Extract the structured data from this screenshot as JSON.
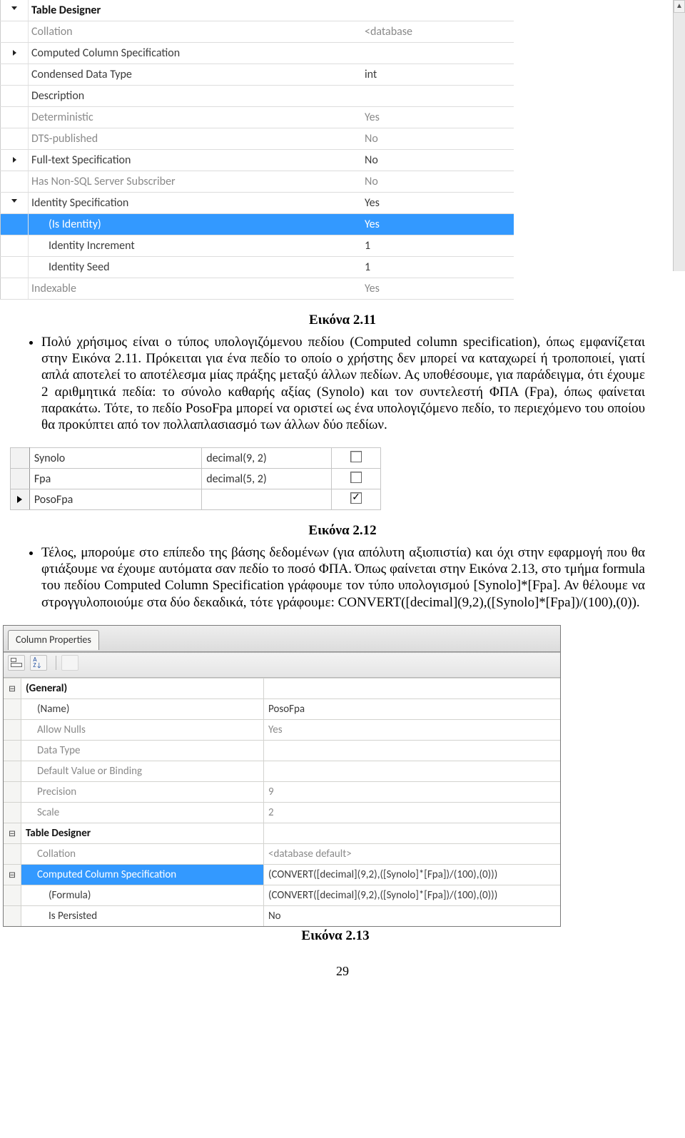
{
  "panel1": {
    "rows": [
      {
        "exp": "open",
        "label": "Table Designer",
        "value": "",
        "style": "header"
      },
      {
        "exp": "",
        "label": "Collation",
        "value": "<database",
        "style": "grey"
      },
      {
        "exp": "right",
        "label": "Computed Column Specification",
        "value": "",
        "style": ""
      },
      {
        "exp": "",
        "label": "Condensed Data Type",
        "value": "int",
        "style": ""
      },
      {
        "exp": "",
        "label": "Description",
        "value": "",
        "style": ""
      },
      {
        "exp": "",
        "label": "Deterministic",
        "value": "Yes",
        "style": "grey"
      },
      {
        "exp": "",
        "label": "DTS-published",
        "value": "No",
        "style": "grey"
      },
      {
        "exp": "right",
        "label": "Full-text Specification",
        "value": "No",
        "style": ""
      },
      {
        "exp": "",
        "label": "Has Non-SQL Server Subscriber",
        "value": "No",
        "style": "grey"
      },
      {
        "exp": "open",
        "label": "Identity Specification",
        "value": "Yes",
        "style": ""
      },
      {
        "exp": "",
        "label": "(Is Identity)",
        "value": "Yes",
        "style": "selected"
      },
      {
        "exp": "",
        "label": "Identity Increment",
        "value": "1",
        "style": "sub"
      },
      {
        "exp": "",
        "label": "Identity Seed",
        "value": "1",
        "style": "sub"
      },
      {
        "exp": "",
        "label": "Indexable",
        "value": "Yes",
        "style": "last"
      }
    ]
  },
  "cap1": "Εικόνα 2.11",
  "para1": "Πολύ χρήσιμος είναι ο τύπος υπολογιζόμενου πεδίου (Computed column specification), όπως εμφανίζεται στην Εικόνα 2.11. Πρόκειται για ένα πεδίο το οποίο ο χρήστης δεν μπορεί να καταχωρεί ή τροποποιεί, γιατί απλά αποτελεί το αποτέλεσμα μίας πράξης μεταξύ άλλων πεδίων. Ας υποθέσουμε, για παράδειγμα, ότι έχουμε 2 αριθμητικά πεδία: το σύνολο καθαρής αξίας (Synolo) και τον συντελεστή ΦΠΑ (Fpa), όπως φαίνεται παρακάτω. Τότε, το πεδίο PosoFpa μπορεί να οριστεί ως ένα υπολογιζόμενο πεδίο, το περιεχόμενο του οποίου θα προκύπτει από τον πολλαπλασιασμό των άλλων δύο πεδίων.",
  "grid": {
    "rows": [
      {
        "ptr": false,
        "name": "Synolo",
        "type": "decimal(9, 2)",
        "chk": false
      },
      {
        "ptr": false,
        "name": "Fpa",
        "type": "decimal(5, 2)",
        "chk": false
      },
      {
        "ptr": true,
        "name": "PosoFpa",
        "type": "",
        "chk": true
      }
    ]
  },
  "cap2": "Εικόνα 2.12",
  "para2": "Τέλος, μπορούμε στο επίπεδο της βάσης δεδομένων (για απόλυτη αξιοπιστία) και όχι στην εφαρμογή που θα φτιάξουμε να έχουμε αυτόματα σαν πεδίο το ποσό ΦΠΑ. Όπως φαίνεται στην Εικόνα 2.13, στο τμήμα formula του πεδίου Computed Column Specification γράφουμε τον τύπο υπολογισμού [Synolo]*[Fpa]. Αν θέλουμε να στρογγυλοποιούμε στα δύο δεκαδικά, τότε γράφουμε: CONVERT([decimal](9,2),([Synolo]*[Fpa])/(100),(0)).",
  "panel3": {
    "tab": "Column Properties",
    "rows": [
      {
        "exp": "⊟",
        "label": "(General)",
        "value": "",
        "style": "cat"
      },
      {
        "exp": "",
        "label": "(Name)",
        "value": "PosoFpa",
        "style": "sub"
      },
      {
        "exp": "",
        "label": "Allow Nulls",
        "value": "Yes",
        "style": "sub grey"
      },
      {
        "exp": "",
        "label": "Data Type",
        "value": "",
        "style": "sub grey"
      },
      {
        "exp": "",
        "label": "Default Value or Binding",
        "value": "",
        "style": "sub grey"
      },
      {
        "exp": "",
        "label": "Precision",
        "value": "9",
        "style": "sub grey"
      },
      {
        "exp": "",
        "label": "Scale",
        "value": "2",
        "style": "sub grey"
      },
      {
        "exp": "⊟",
        "label": "Table Designer",
        "value": "",
        "style": "cat"
      },
      {
        "exp": "",
        "label": "Collation",
        "value": "<database default>",
        "style": "sub grey"
      },
      {
        "exp": "⊟",
        "label": "Computed Column Specification",
        "value": "(CONVERT([decimal](9,2),([Synolo]*[Fpa])/(100),(0)))",
        "style": "sub sel"
      },
      {
        "exp": "",
        "label": "(Formula)",
        "value": "(CONVERT([decimal](9,2),([Synolo]*[Fpa])/(100),(0)))",
        "style": "sub2"
      },
      {
        "exp": "",
        "label": "Is Persisted",
        "value": "No",
        "style": "sub2"
      }
    ]
  },
  "cap3": "Εικόνα 2.13",
  "page": "29"
}
